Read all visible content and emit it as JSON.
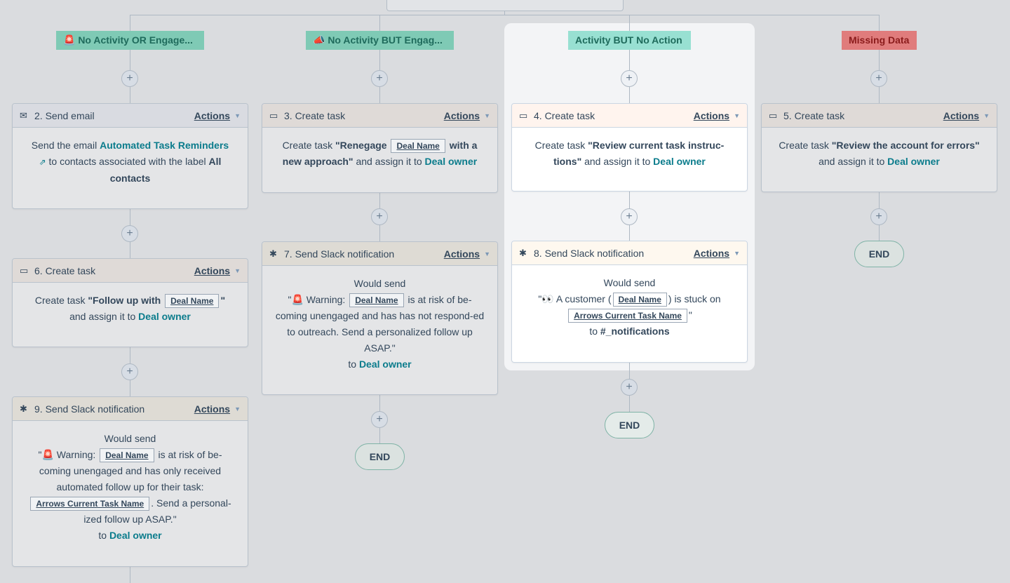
{
  "branches": [
    {
      "label": "🚨 No Activity OR Engage...",
      "color": "#7fcab5"
    },
    {
      "label": "📣 No Activity BUT Engag...",
      "color": "#7fcab5"
    },
    {
      "label": "Activity BUT No Action",
      "color": "#98e0d2"
    },
    {
      "label": "Missing Data",
      "color": "#e07c7c"
    }
  ],
  "plus_label": "+",
  "actions_label": "Actions",
  "end_label": "END",
  "cards": {
    "c2": {
      "title": "2. Send email",
      "icon": "envelope-icon",
      "p1": "Send the email ",
      "link1": "Automated Task Reminders",
      "p2": " to contacts associated with the label ",
      "bold1": "All contacts"
    },
    "c3": {
      "title": "3. Create task",
      "icon": "task-icon",
      "p1": "Create task ",
      "bold1": "\"Renegage ",
      "token1": "Deal Name",
      "bold2": " with a new approach\"",
      "p2": " and assign it to ",
      "link1": "Deal owner"
    },
    "c4": {
      "title": "4. Create task",
      "icon": "task-icon",
      "p1": "Create task ",
      "bold1": "\"Review current task instruc-tions\"",
      "p2": " and assign it to ",
      "link1": "Deal owner"
    },
    "c5": {
      "title": "5. Create task",
      "icon": "task-icon",
      "p1": "Create task ",
      "bold1": "\"Review the account for errors\"",
      "p2": " and assign it to ",
      "link1": "Deal owner"
    },
    "c6": {
      "title": "6. Create task",
      "icon": "task-icon",
      "p1": "Create task ",
      "bold1": "\"Follow up with ",
      "token1": "Deal Name",
      "bold2": "\"",
      "p2": " and assign it to ",
      "link1": "Deal owner"
    },
    "c7": {
      "title": "7. Send Slack notification",
      "icon": "slack-icon",
      "l1": "Would send",
      "p1": "\"🚨 Warning: ",
      "token1": "Deal Name",
      "p2": " is at risk of be-coming unengaged and has has not respond-ed to outreach. Send a personalized follow up ASAP.\"",
      "p3": "to ",
      "link1": "Deal owner"
    },
    "c8": {
      "title": "8. Send Slack notification",
      "icon": "slack-icon",
      "l1": "Would send",
      "p1": "\"👀 A customer (",
      "token1": "Deal Name",
      "p2": ") is stuck on",
      "token2": "Arrows Current Task Name",
      "p3": "\"",
      "p4": "to ",
      "bold1": "#_notifications"
    },
    "c9": {
      "title": "9. Send Slack notification",
      "icon": "slack-icon",
      "l1": "Would send",
      "p1": "\"🚨 Warning: ",
      "token1": "Deal Name",
      "p2": " is at risk of be-coming unengaged and has only received automated follow up for their task:",
      "token2": "Arrows Current Task Name",
      "p3": ". Send a personal-ized follow up ASAP.\"",
      "p4": "to ",
      "link1": "Deal owner"
    }
  }
}
